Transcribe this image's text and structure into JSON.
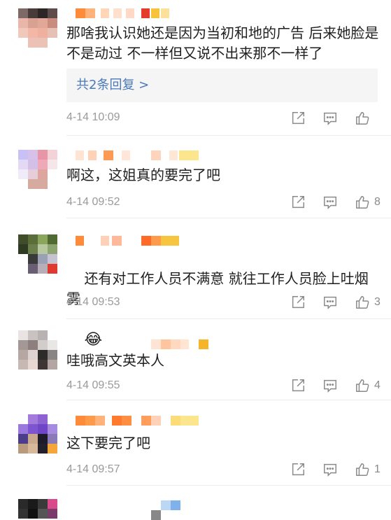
{
  "comments": [
    {
      "text": "那啥我认识她还是因为当初和地的广告 后来她脸是不是动过 不一样但又说不出来那不一样了",
      "reply_label": "共2条回复 >",
      "time": "4-14 10:09",
      "likes": ""
    },
    {
      "text": "啊这，这姐真的要完了吧",
      "time": "4-14 09:52",
      "likes": "8"
    },
    {
      "text": "还有对工作人员不满意 就往工作人员脸上吐烟雾",
      "emoji": "😂",
      "time": "4-14 09:53",
      "likes": "3"
    },
    {
      "text": "哇哦高文英本人",
      "time": "4-14 09:55",
      "likes": "4"
    },
    {
      "text": "这下要完了吧",
      "time": "4-14 09:57",
      "likes": "1"
    }
  ],
  "icons": {
    "share": "share-icon",
    "comment": "comment-icon",
    "like": "thumbs-up-icon"
  },
  "colors": {
    "reply_link": "#4a78b8",
    "time": "#9a9a9a",
    "icon": "#8a8a8a"
  }
}
